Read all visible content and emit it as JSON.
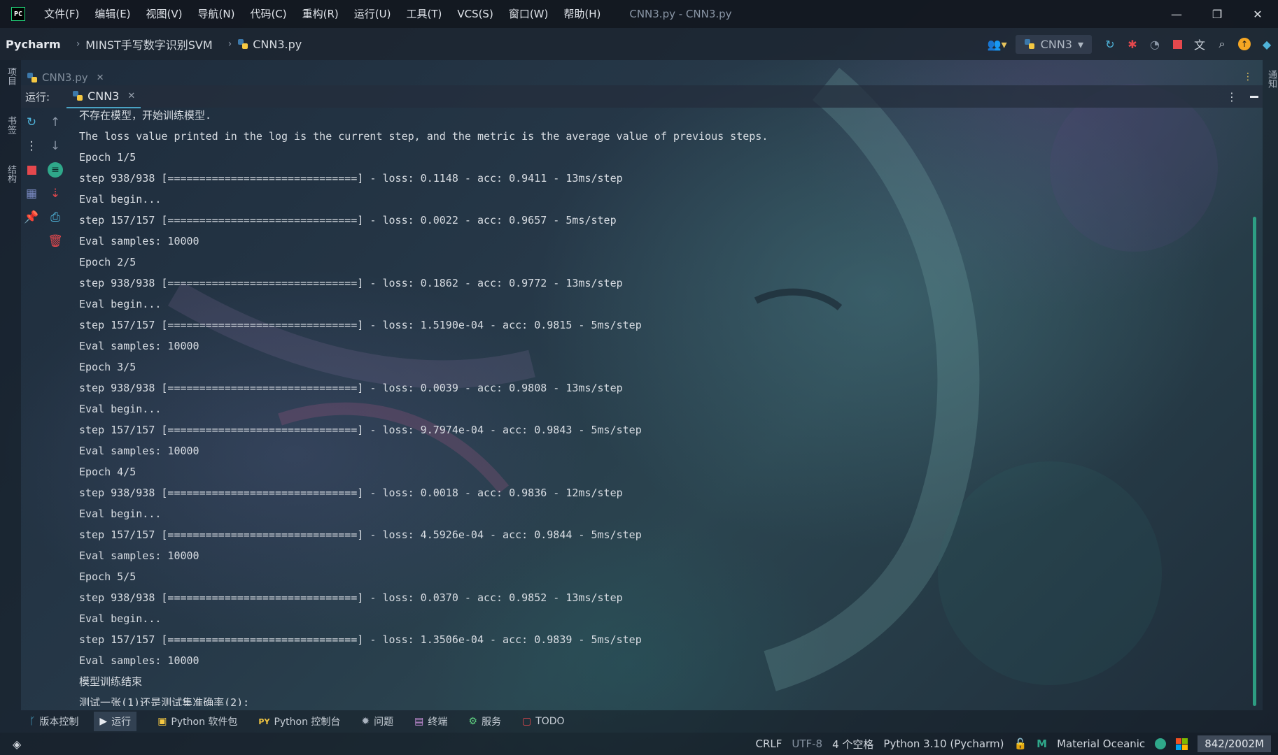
{
  "titlebar": {
    "app_icon": "PC",
    "menu": [
      "文件(F)",
      "编辑(E)",
      "视图(V)",
      "导航(N)",
      "代码(C)",
      "重构(R)",
      "运行(U)",
      "工具(T)",
      "VCS(S)",
      "窗口(W)",
      "帮助(H)"
    ],
    "window_title": "CNN3.py - CNN3.py",
    "controls": {
      "minimize": "—",
      "restore": "❐",
      "close": "✕"
    }
  },
  "navbar": {
    "project": "Pycharm",
    "breadcrumbs": [
      "MINST手写数字识别SVM",
      "CNN3.py"
    ],
    "run_config": "CNN3",
    "icons": [
      "users-icon",
      "rerun-icon",
      "debug-icon",
      "coverage-icon",
      "stop-icon",
      "translate-icon",
      "search-icon",
      "update-icon",
      "plugin-icon"
    ]
  },
  "left_strip": {
    "tabs": [
      "项目",
      "书签",
      "结构"
    ]
  },
  "right_strip": {
    "tabs": [
      "通知"
    ]
  },
  "editor": {
    "tab": "CNN3.py"
  },
  "run": {
    "label": "运行:",
    "tab": "CNN3"
  },
  "console": {
    "lines": [
      "不存在模型，开始训练模型.",
      "The loss value printed in the log is the current step, and the metric is the average value of previous steps.",
      "Epoch 1/5",
      "step 938/938 [==============================] - loss: 0.1148 - acc: 0.9411 - 13ms/step",
      "Eval begin...",
      "step 157/157 [==============================] - loss: 0.0022 - acc: 0.9657 - 5ms/step",
      "Eval samples: 10000",
      "Epoch 2/5",
      "step 938/938 [==============================] - loss: 0.1862 - acc: 0.9772 - 13ms/step",
      "Eval begin...",
      "step 157/157 [==============================] - loss: 1.5190e-04 - acc: 0.9815 - 5ms/step",
      "Eval samples: 10000",
      "Epoch 3/5",
      "step 938/938 [==============================] - loss: 0.0039 - acc: 0.9808 - 13ms/step",
      "Eval begin...",
      "step 157/157 [==============================] - loss: 9.7974e-04 - acc: 0.9843 - 5ms/step",
      "Eval samples: 10000",
      "Epoch 4/5",
      "step 938/938 [==============================] - loss: 0.0018 - acc: 0.9836 - 12ms/step",
      "Eval begin...",
      "step 157/157 [==============================] - loss: 4.5926e-04 - acc: 0.9844 - 5ms/step",
      "Eval samples: 10000",
      "Epoch 5/5",
      "step 938/938 [==============================] - loss: 0.0370 - acc: 0.9852 - 13ms/step",
      "Eval begin...",
      "step 157/157 [==============================] - loss: 1.3506e-04 - acc: 0.9839 - 5ms/step",
      "Eval samples: 10000",
      "模型训练结束",
      "测试一张(1)还是测试集准确率(2):"
    ]
  },
  "bottom_tabs": [
    "版本控制",
    "运行",
    "Python 软件包",
    "Python 控制台",
    "问题",
    "终端",
    "服务",
    "TODO"
  ],
  "statusbar": {
    "line_sep": "CRLF",
    "encoding": "UTF-8",
    "indent": "4 个空格",
    "interpreter": "Python 3.10 (Pycharm)",
    "theme": "Material Oceanic",
    "memory": "842/2002M"
  },
  "colors": {
    "accent": "#2fa88a",
    "stop": "#e5484d",
    "titlebar": "#131820"
  }
}
